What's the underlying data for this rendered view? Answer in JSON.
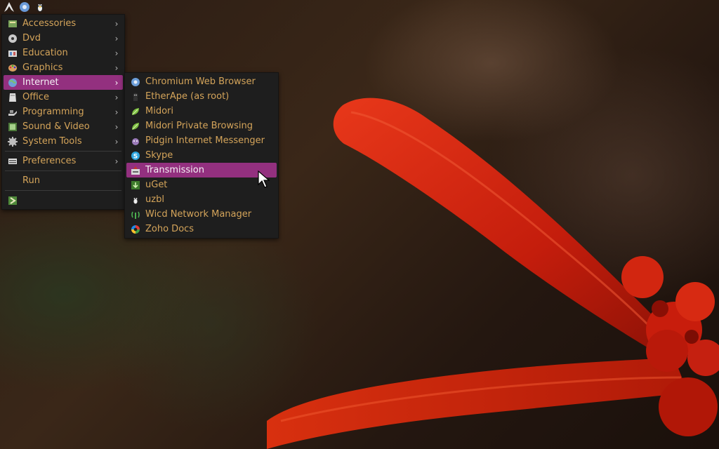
{
  "topbar": {
    "icons": [
      "arch-logo-icon",
      "browser-globe-icon",
      "tux-icon"
    ]
  },
  "main_menu": {
    "items": [
      {
        "label": "Accessories",
        "icon": "accessories-icon",
        "submenu": true
      },
      {
        "label": "Dvd",
        "icon": "dvd-icon",
        "submenu": true
      },
      {
        "label": "Education",
        "icon": "education-icon",
        "submenu": true
      },
      {
        "label": "Graphics",
        "icon": "graphics-palette-icon",
        "submenu": true
      },
      {
        "label": "Internet",
        "icon": "internet-globe-icon",
        "submenu": true,
        "active": true
      },
      {
        "label": "Office",
        "icon": "office-icon",
        "submenu": true
      },
      {
        "label": "Programming",
        "icon": "programming-icon",
        "submenu": true
      },
      {
        "label": "Sound & Video",
        "icon": "sound-video-icon",
        "submenu": true
      },
      {
        "label": "System Tools",
        "icon": "system-tools-gear-icon",
        "submenu": true
      },
      {
        "label": "Preferences",
        "icon": "preferences-icon",
        "submenu": true
      },
      {
        "label": "Run",
        "icon": "",
        "submenu": false
      },
      {
        "label": "",
        "icon": "logout-icon",
        "submenu": false
      }
    ]
  },
  "internet_submenu": {
    "items": [
      {
        "label": "Chromium Web Browser",
        "icon": "chromium-icon"
      },
      {
        "label": "EtherApe (as root)",
        "icon": "etherape-icon"
      },
      {
        "label": "Midori",
        "icon": "midori-leaf-icon"
      },
      {
        "label": "Midori Private Browsing",
        "icon": "midori-private-icon"
      },
      {
        "label": "Pidgin Internet Messenger",
        "icon": "pidgin-icon"
      },
      {
        "label": "Skype",
        "icon": "skype-icon"
      },
      {
        "label": "Transmission",
        "icon": "transmission-icon",
        "active": true
      },
      {
        "label": "uGet",
        "icon": "uget-icon"
      },
      {
        "label": "uzbl",
        "icon": "uzbl-icon"
      },
      {
        "label": "Wicd Network Manager",
        "icon": "wicd-icon"
      },
      {
        "label": "Zoho Docs",
        "icon": "zoho-docs-icon"
      }
    ]
  },
  "colors": {
    "menu_bg": "#1e1e1e",
    "text": "#d4a45a",
    "highlight": "#93307f",
    "highlight_text": "#f4f0f4"
  }
}
